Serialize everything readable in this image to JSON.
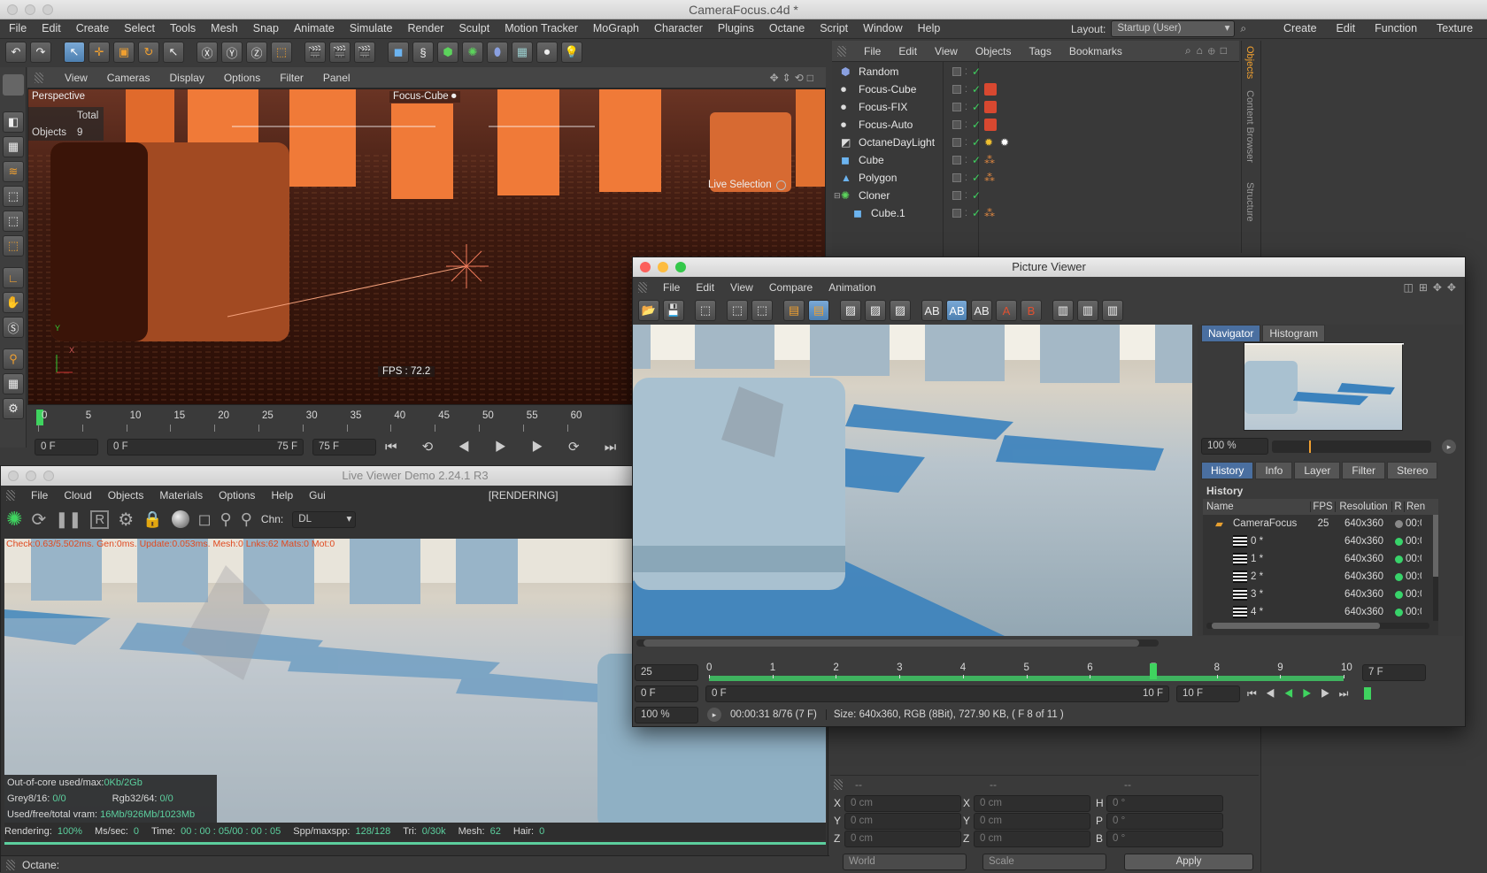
{
  "window_title": "CameraFocus.c4d *",
  "main_menu": [
    "File",
    "Edit",
    "Create",
    "Select",
    "Tools",
    "Mesh",
    "Snap",
    "Animate",
    "Simulate",
    "Render",
    "Sculpt",
    "Motion Tracker",
    "MoGraph",
    "Character",
    "Plugins",
    "Octane",
    "Script",
    "Window",
    "Help"
  ],
  "layout": {
    "label": "Layout:",
    "value": "Startup (User)"
  },
  "right_menu": [
    "Create",
    "Edit",
    "Function",
    "Texture"
  ],
  "viewport": {
    "menu": [
      "View",
      "Cameras",
      "Display",
      "Options",
      "Filter",
      "Panel"
    ],
    "label": "Perspective",
    "camera_label": "Focus-Cube",
    "hud_total": "Total",
    "hud_objects_label": "Objects",
    "hud_objects_value": "9",
    "live_selection": "Live Selection",
    "fps": "FPS : 72.2",
    "axis_y": "Y",
    "axis_x": "X"
  },
  "timeline": {
    "ticks": [
      "0",
      "5",
      "10",
      "15",
      "20",
      "25",
      "30",
      "35",
      "40",
      "45",
      "50",
      "55",
      "60"
    ],
    "start_field": "0 F",
    "range_start": "0 F",
    "range_end": "75 F",
    "end_field": "75 F"
  },
  "object_manager": {
    "menu": [
      "File",
      "Edit",
      "View",
      "Objects",
      "Tags",
      "Bookmarks"
    ],
    "objects": [
      {
        "name": "Random",
        "indent": 0
      },
      {
        "name": "Focus-Cube",
        "indent": 0
      },
      {
        "name": "Focus-FIX",
        "indent": 0
      },
      {
        "name": "Focus-Auto",
        "indent": 0
      },
      {
        "name": "OctaneDayLight",
        "indent": 0
      },
      {
        "name": "Cube",
        "indent": 0
      },
      {
        "name": "Polygon",
        "indent": 0
      },
      {
        "name": "Cloner",
        "indent": 0
      },
      {
        "name": "Cube.1",
        "indent": 1
      }
    ],
    "side_tabs": [
      "Objects",
      "Content Browser",
      "Structure"
    ]
  },
  "live_viewer": {
    "title": "Live Viewer Demo 2.24.1 R3",
    "menu": [
      "File",
      "Cloud",
      "Objects",
      "Materials",
      "Options",
      "Help",
      "Gui"
    ],
    "status": "[RENDERING]",
    "chn_label": "Chn:",
    "chn_value": "DL",
    "stats_line": "Check:0.63/5.502ms. Gen:0ms. Update:0.053ms. Mesh:0 Lnks:62 Mats:0 Mot:0",
    "ooc_label": "Out-of-core used/max:",
    "ooc_value": "0Kb/2Gb",
    "grey_label": "Grey8/16:",
    "grey_value": "0/0",
    "rgb_label": "Rgb32/64:",
    "rgb_value": "0/0",
    "vram_label": "Used/free/total vram:",
    "vram_value": "16Mb/926Mb/1023Mb",
    "rendering_label": "Rendering:",
    "rendering_value": "100%",
    "mssec_label": "Ms/sec:",
    "mssec_value": "0",
    "time_label": "Time:",
    "time_value": "00 : 00 : 05/00 : 00 : 05",
    "spp_label": "Spp/maxspp:",
    "spp_value": "128/128",
    "tri_label": "Tri:",
    "tri_value": "0/30k",
    "mesh_label": "Mesh:",
    "mesh_value": "62",
    "hair_label": "Hair:",
    "hair_value": "0",
    "render_progress": 1.0
  },
  "picture_viewer": {
    "title": "Picture Viewer",
    "menu": [
      "File",
      "Edit",
      "View",
      "Compare",
      "Animation"
    ],
    "nav_tabs": [
      "Navigator",
      "Histogram"
    ],
    "zoom": "100 %",
    "tabs": [
      "History",
      "Info",
      "Layer",
      "Filter",
      "Stereo"
    ],
    "history_title": "History",
    "columns": [
      "Name",
      "FPS",
      "Resolution",
      "R",
      "Ren"
    ],
    "rows": [
      {
        "name": "CameraFocus",
        "fps": "25",
        "res": "640x360",
        "ren": "00:0",
        "folder": true
      },
      {
        "name": "0 *",
        "fps": "",
        "res": "640x360",
        "ren": "00:0",
        "folder": false
      },
      {
        "name": "1 *",
        "fps": "",
        "res": "640x360",
        "ren": "00:0",
        "folder": false
      },
      {
        "name": "2 *",
        "fps": "",
        "res": "640x360",
        "ren": "00:0",
        "folder": false
      },
      {
        "name": "3 *",
        "fps": "",
        "res": "640x360",
        "ren": "00:0",
        "folder": false
      },
      {
        "name": "4 *",
        "fps": "",
        "res": "640x360",
        "ren": "00:0",
        "folder": false
      }
    ],
    "fps_field": "25",
    "frame_ticks": [
      "0",
      "1",
      "2",
      "3",
      "4",
      "5",
      "6",
      "7",
      "8",
      "9",
      "10"
    ],
    "current_frame_field": "7 F",
    "start_field": "0 F",
    "range_start": "0 F",
    "range_end": "10 F",
    "end_field": "10 F",
    "bottom_zoom": "100 %",
    "time_info": "00:00:31 8/76 (7 F)",
    "size_info": "Size: 640x360, RGB (8Bit), 727.90 KB,  ( F 8 of 11 )"
  },
  "coords": {
    "headers": [
      "--",
      "--",
      "--"
    ],
    "rows": [
      {
        "a": "X",
        "av": "0 cm",
        "b": "X",
        "bv": "0 cm",
        "c": "H",
        "cv": "0 °"
      },
      {
        "a": "Y",
        "av": "0 cm",
        "b": "Y",
        "bv": "0 cm",
        "c": "P",
        "cv": "0 °"
      },
      {
        "a": "Z",
        "av": "0 cm",
        "b": "Z",
        "bv": "0 cm",
        "c": "B",
        "cv": "0 °"
      }
    ],
    "world": "World",
    "scale": "Scale",
    "apply": "Apply"
  },
  "status_bar": "Octane:"
}
